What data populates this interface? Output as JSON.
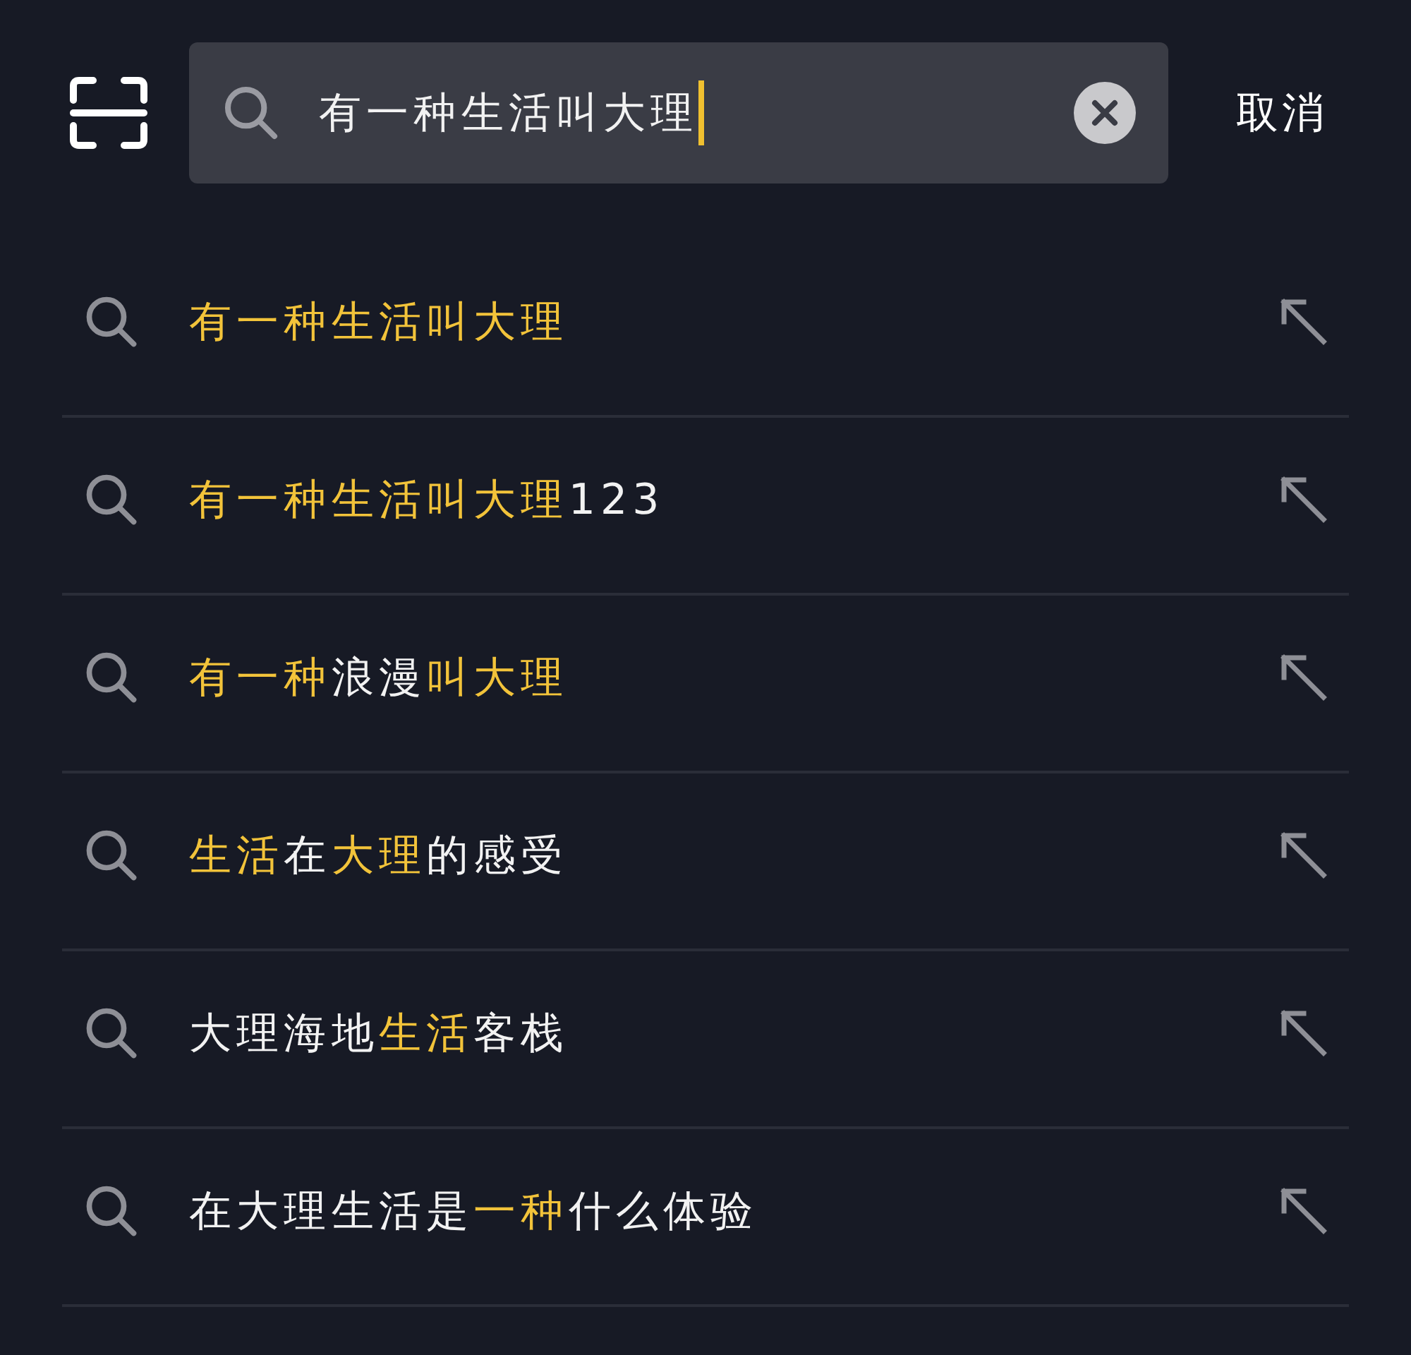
{
  "search": {
    "value": "有一种生活叫大理",
    "cancel": "取消"
  },
  "suggestions": [
    {
      "segments": [
        {
          "text": "有一种生活叫大理",
          "highlight": true
        }
      ]
    },
    {
      "segments": [
        {
          "text": "有一种生活叫大理",
          "highlight": true
        },
        {
          "text": "123",
          "highlight": false
        }
      ]
    },
    {
      "segments": [
        {
          "text": "有一种",
          "highlight": true
        },
        {
          "text": "浪漫",
          "highlight": false
        },
        {
          "text": "叫大理",
          "highlight": true
        }
      ]
    },
    {
      "segments": [
        {
          "text": "生活",
          "highlight": true
        },
        {
          "text": "在",
          "highlight": false
        },
        {
          "text": "大理",
          "highlight": true
        },
        {
          "text": "的感受",
          "highlight": false
        }
      ]
    },
    {
      "segments": [
        {
          "text": "大理海地",
          "highlight": false
        },
        {
          "text": "生活",
          "highlight": true
        },
        {
          "text": "客栈",
          "highlight": false
        }
      ]
    },
    {
      "segments": [
        {
          "text": "在大理生活是",
          "highlight": false
        },
        {
          "text": "一种",
          "highlight": true
        },
        {
          "text": "什么体验",
          "highlight": false
        }
      ]
    }
  ]
}
